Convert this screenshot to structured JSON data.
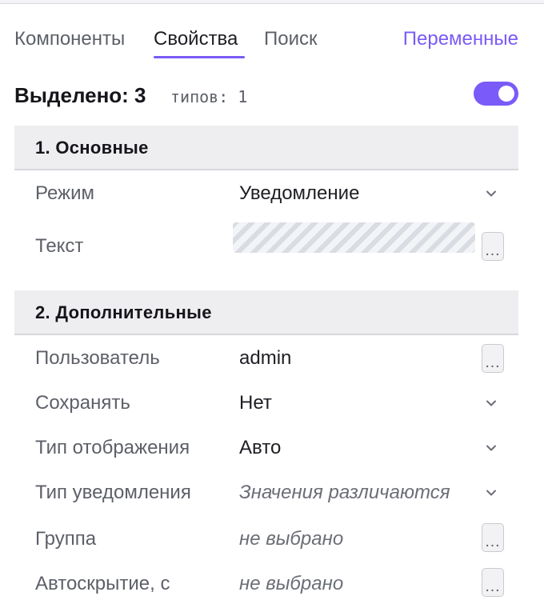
{
  "tabs": {
    "components": "Компоненты",
    "properties": "Свойства",
    "search": "Поиск",
    "variables": "Переменные"
  },
  "selection": {
    "label": "Выделено: 3",
    "types": "типов: 1",
    "toggle_on": true
  },
  "colors": {
    "accent": "#7a5af8",
    "section_bg": "#eeeef1"
  },
  "sections": {
    "basic": {
      "title": "1. Основные",
      "mode": {
        "label": "Режим",
        "value": "Уведомление"
      },
      "text": {
        "label": "Текст",
        "button": "…"
      }
    },
    "extra": {
      "title": "2. Дополнительные",
      "user": {
        "label": "Пользователь",
        "value": "admin",
        "button": "…"
      },
      "save": {
        "label": "Сохранять",
        "value": "Нет"
      },
      "display_type": {
        "label": "Тип отображения",
        "value": "Авто"
      },
      "notify_type": {
        "label": "Тип уведомления",
        "value": "Значения различаются"
      },
      "group": {
        "label": "Группа",
        "value": "не выбрано",
        "button": "…"
      },
      "autohide": {
        "label": "Автоскрытие, с",
        "value": "не выбрано",
        "button": "…"
      }
    }
  },
  "icons": {
    "dropdown": "chevron-down-icon",
    "more": "ellipsis-icon"
  }
}
